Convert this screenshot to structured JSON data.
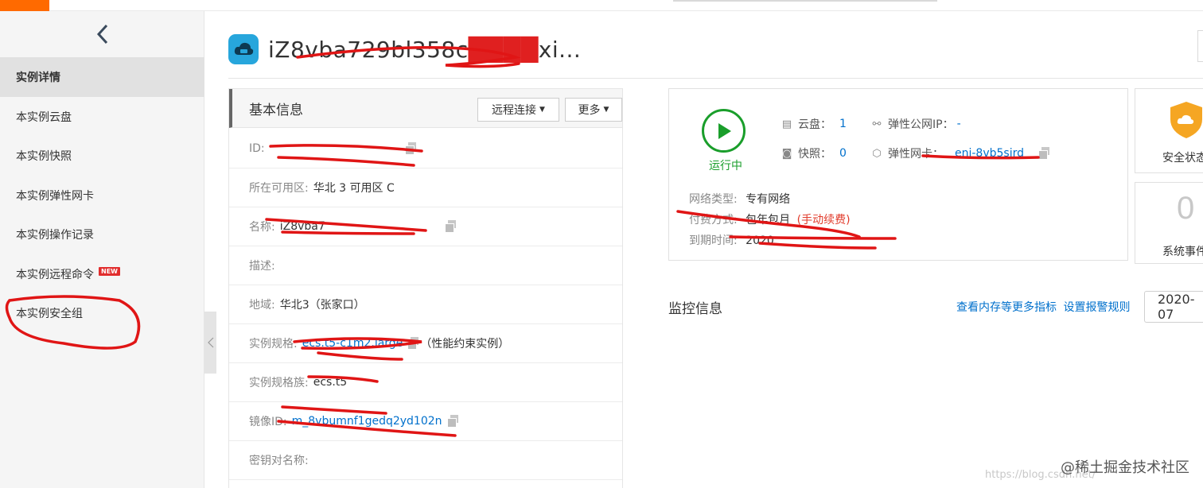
{
  "topbar": {
    "brand_color": "#ff6a00"
  },
  "sidebar": {
    "back_icon": "chevron-left-icon",
    "items": [
      {
        "label": "实例详情",
        "active": true
      },
      {
        "label": "本实例云盘"
      },
      {
        "label": "本实例快照"
      },
      {
        "label": "本实例弹性网卡"
      },
      {
        "label": "本实例操作记录"
      },
      {
        "label": "本实例远程命令",
        "badge": "NEW"
      },
      {
        "label": "本实例安全组"
      }
    ]
  },
  "header": {
    "title": "iZ8vba729bl358c",
    "title_tail": "xi...",
    "icon": "cloud-server-icon"
  },
  "basic_info": {
    "title": "基本信息",
    "remote_btn": "远程连接",
    "more_btn": "更多",
    "rows": [
      {
        "key": "ID:",
        "value": ""
      },
      {
        "key": "所在可用区:",
        "value": "华北 3 可用区 C"
      },
      {
        "key": "名称:",
        "value": "iZ8vba7"
      },
      {
        "key": "描述:",
        "value": ""
      },
      {
        "key": "地域:",
        "value": "华北3（张家口）"
      },
      {
        "key": "实例规格:",
        "value": "ecs.t5-c1m2.large",
        "suffix": "（性能约束实例）"
      },
      {
        "key": "实例规格族:",
        "value": "ecs.t5"
      },
      {
        "key": "镜像ID:",
        "value": "m_8vbumnf1gedq2yd102n"
      },
      {
        "key": "密钥对名称:",
        "value": ""
      }
    ]
  },
  "status": {
    "state": "运行中",
    "disk_label": "云盘：",
    "disk_value": "1",
    "snapshot_label": "快照：",
    "snapshot_value": "0",
    "eip_label": "弹性公网IP：",
    "eip_value": "-",
    "eni_label": "弹性网卡：",
    "eni_value": "eni-8vb5sird",
    "network_type_key": "网络类型:",
    "network_type_value": "专有网络",
    "billing_key": "付费方式:",
    "billing_value": "包年包月",
    "billing_note": "(手动续费)",
    "expire_key": "到期时间:",
    "expire_value": "2020"
  },
  "security": {
    "label": "安全状态",
    "color": "#f5a623"
  },
  "events": {
    "count": "0",
    "label": "系统事件"
  },
  "monitor": {
    "title": "监控信息",
    "more_link": "查看内存等更多指标",
    "alarm_link": "设置报警规则",
    "date": "2020-07"
  },
  "watermark": {
    "text": "@稀土掘金技术社区",
    "url": "https://blog.csdn.net/"
  },
  "colors": {
    "link": "#0070cc",
    "running": "#1a9e2b",
    "alert": "#e13b2b"
  }
}
